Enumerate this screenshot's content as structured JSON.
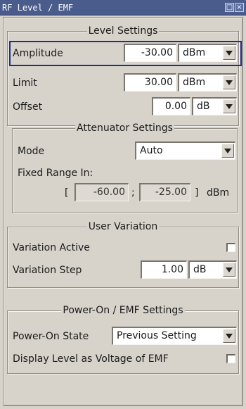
{
  "window": {
    "title": "RF Level / EMF"
  },
  "level_settings": {
    "title": "Level Settings",
    "amplitude": {
      "label": "Amplitude",
      "value": "-30.00",
      "unit": "dBm"
    },
    "limit": {
      "label": "Limit",
      "value": "30.00",
      "unit": "dBm"
    },
    "offset": {
      "label": "Offset",
      "value": "0.00",
      "unit": "dB"
    }
  },
  "attenuator_settings": {
    "title": "Attenuator Settings",
    "mode": {
      "label": "Mode",
      "value": "Auto"
    },
    "fixed_range": {
      "label": "Fixed Range In:",
      "open_bracket": "[",
      "min": "-60.00",
      "separator": ";",
      "max": "-25.00",
      "close_bracket": "]",
      "unit": "dBm"
    }
  },
  "user_variation": {
    "title": "User Variation",
    "variation_active": {
      "label": "Variation Active",
      "checked": false
    },
    "variation_step": {
      "label": "Variation Step",
      "value": "1.00",
      "unit": "dB"
    }
  },
  "power_on_emf": {
    "title": "Power-On / EMF Settings",
    "power_on_state": {
      "label": "Power-On State",
      "value": "Previous Setting"
    },
    "display_level": {
      "label": "Display Level as Voltage of EMF",
      "checked": false
    }
  },
  "colors": {
    "titlebar": "#4a5c8c",
    "focus": "#1f2e8c",
    "panel": "#d7d3cb"
  }
}
